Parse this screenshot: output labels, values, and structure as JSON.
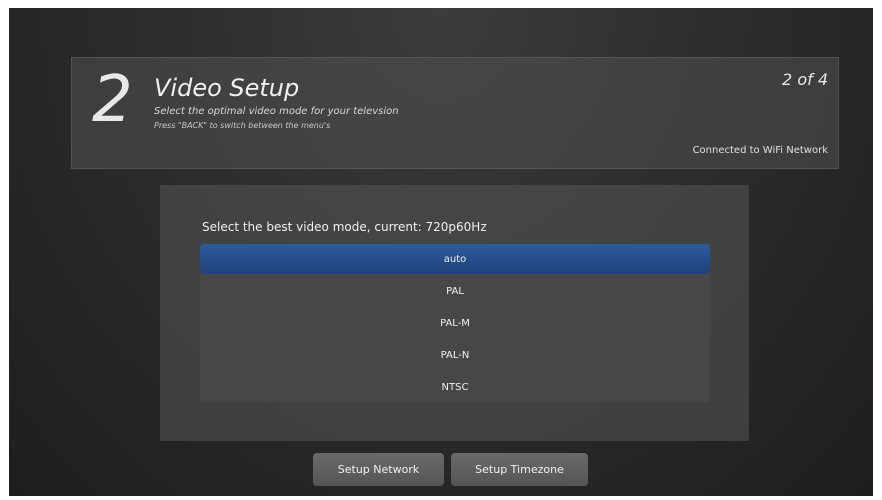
{
  "header": {
    "step_number": "2",
    "title": "Video Setup",
    "subtitle": "Select the optimal video mode for your televsion",
    "hint": "Press \"BACK\" to switch between the menu's",
    "step_counter": "2 of 4",
    "connection_status": "Connected to WiFi Network"
  },
  "panel": {
    "prompt": "Select the best video mode, current: 720p60Hz",
    "modes": [
      {
        "label": "auto",
        "selected": true
      },
      {
        "label": "PAL",
        "selected": false
      },
      {
        "label": "PAL-M",
        "selected": false
      },
      {
        "label": "PAL-N",
        "selected": false
      },
      {
        "label": "NTSC",
        "selected": false
      }
    ]
  },
  "buttons": {
    "setup_network": "Setup Network",
    "setup_timezone": "Setup Timezone"
  },
  "colors": {
    "selection_blue": "#2a4f8c",
    "background": "#2a2a2a"
  }
}
